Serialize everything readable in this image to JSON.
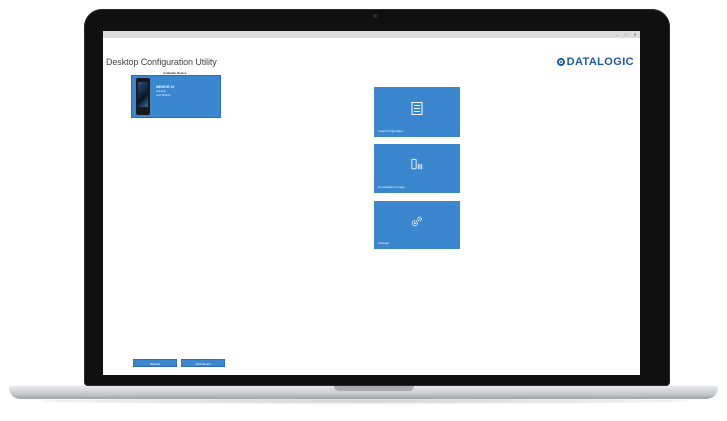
{
  "window": {
    "controls": [
      "–",
      "□",
      "✕"
    ]
  },
  "app": {
    "title": "Desktop Configuration Utility",
    "logo_text": "DATALOGIC",
    "brand_color": "#1d5aa6",
    "tile_color": "#3a87cf"
  },
  "devices": {
    "label": "Available Device",
    "card": {
      "name": "MEMOR 10",
      "lines": [
        "unknown",
        "Imei 354978..."
      ]
    }
  },
  "tiles": [
    {
      "label": "Load Configuration",
      "icon": "document-list-icon"
    },
    {
      "label": "Consolidated Image",
      "icon": "device-barcode-icon"
    },
    {
      "label": "Settings",
      "icon": "gears-icon"
    }
  ],
  "footer": {
    "refresh_label": "Refresh",
    "add_device_label": "Add Device"
  }
}
